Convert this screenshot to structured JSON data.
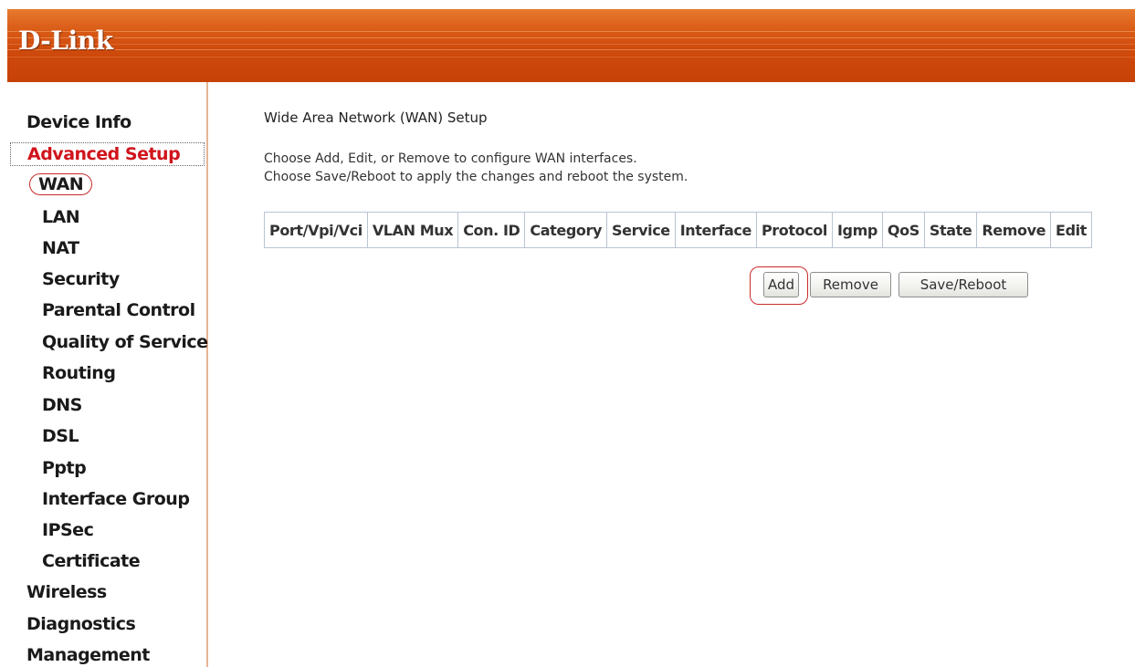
{
  "header": {
    "logo_text": "D-Link",
    "brand_color": "#d4520f"
  },
  "sidebar": {
    "items": [
      {
        "label": "Device Info",
        "level": 0
      },
      {
        "label": "Advanced Setup",
        "level": 0,
        "active": true
      },
      {
        "label": "WAN",
        "level": 1,
        "highlighted": true
      },
      {
        "label": "LAN",
        "level": 1
      },
      {
        "label": "NAT",
        "level": 1
      },
      {
        "label": "Security",
        "level": 1
      },
      {
        "label": "Parental Control",
        "level": 1
      },
      {
        "label": "Quality of Service",
        "level": 1
      },
      {
        "label": "Routing",
        "level": 1
      },
      {
        "label": "DNS",
        "level": 1
      },
      {
        "label": "DSL",
        "level": 1
      },
      {
        "label": "Pptp",
        "level": 1
      },
      {
        "label": "Interface Group",
        "level": 1
      },
      {
        "label": "IPSec",
        "level": 1
      },
      {
        "label": "Certificate",
        "level": 1
      },
      {
        "label": "Wireless",
        "level": 0
      },
      {
        "label": "Diagnostics",
        "level": 0
      },
      {
        "label": "Management",
        "level": 0
      }
    ],
    "active_color": "#d0141c"
  },
  "main": {
    "title": "Wide Area Network (WAN) Setup",
    "description_line1": "Choose Add, Edit, or Remove to configure WAN interfaces.",
    "description_line2": "Choose Save/Reboot to apply the changes and reboot the system.",
    "table": {
      "columns": [
        "Port/Vpi/Vci",
        "VLAN Mux",
        "Con. ID",
        "Category",
        "Service",
        "Interface",
        "Protocol",
        "Igmp",
        "QoS",
        "State",
        "Remove",
        "Edit"
      ],
      "rows": []
    },
    "buttons": {
      "add": "Add",
      "remove": "Remove",
      "save_reboot": "Save/Reboot"
    },
    "highlight_color": "#cc2b2b"
  }
}
